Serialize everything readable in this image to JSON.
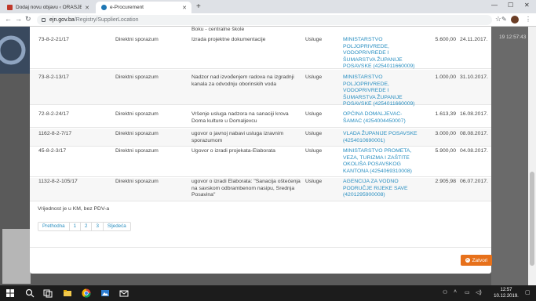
{
  "browser": {
    "tabs": [
      {
        "title": "Dodaj novu objavu ‹ ORAŠJE NET",
        "active": false
      },
      {
        "title": "e-Procurement",
        "active": true
      }
    ],
    "url_host": "ejn.gov.ba",
    "url_path": "/Registry/SupplierLocation"
  },
  "background": {
    "clock_fragment": "19 12:57:43"
  },
  "modal": {
    "top_cutoff_text": "Boku - centralne škole",
    "rows": [
      {
        "number": "73-8-2-21/17",
        "procedure": "Direktni sporazum",
        "subject": "Izrada projektne dokumentacije",
        "type": "Usluge",
        "authority": "MINISTARSTVO POLJOPRIVREDE, VODOPRIVREDE I ŠUMARSTVA ŽUPANIJE POSAVSKE (4254011660009)",
        "value": "5.600,00",
        "date": "24.11.2017."
      },
      {
        "number": "73-8-2-13/17",
        "procedure": "Direktni sporazum",
        "subject": "Nadzor nad izvođenjem radova na izgradnji kanala za odvodnju oborinskih voda",
        "type": "Usluge",
        "authority": "MINISTARSTVO POLJOPRIVREDE, VODOPRIVREDE I ŠUMARSTVA ŽUPANIJE POSAVSKE (4254011660009)",
        "value": "1.000,00",
        "date": "31.10.2017."
      },
      {
        "number": "72-8-2-24/17",
        "procedure": "Direktni sporazum",
        "subject": "Vršenje usluga nadzora na sanaciji krova Doma kulture u Domaljevcu",
        "type": "Usluge",
        "authority": "OPĆINA DOMALJEVAC-ŠAMAC (4254004450007)",
        "value": "1.613,39",
        "date": "16.08.2017."
      },
      {
        "number": "1162-8-2-7/17",
        "procedure": "Direktni sporazum",
        "subject": "ugovor o javnoj nabavi usluga izravnim sporazumom",
        "type": "Usluge",
        "authority": "VLADA ŽUPANIJE POSAVSKE (4254010690001)",
        "value": "3.000,00",
        "date": "08.08.2017."
      },
      {
        "number": "45-8-2-3/17",
        "procedure": "Direktni sporazum",
        "subject": "Ugovor o izradi projekata-Elaborata",
        "type": "Usluge",
        "authority": "MINISTARSTVO PROMETA, VEZA, TURIZMA I ZAŠTITE OKOLIŠA POSAVSKOG KANTONA (4254069310008)",
        "value": "5.900,00",
        "date": "04.08.2017."
      },
      {
        "number": "1132-8-2-105/17",
        "procedure": "Direktni sporazum",
        "subject": "ugovor o izradi Elaborata: \"Sanacija oštećenja na savskom odbrambenom nasipu, Srednja Posavina\"",
        "type": "Usluge",
        "authority": "AGENCIJA ZA VODNO PODRUČJE RIJEKE SAVE (4201295900008)",
        "value": "2.905,98",
        "date": "06.07.2017."
      }
    ],
    "note": "Vrijednost je u KM, bez PDV-a",
    "pagination": [
      "Prethodna",
      "1",
      "2",
      "3",
      "Sljedeća"
    ],
    "close_label": "Zatvori"
  },
  "taskbar": {
    "time": "12:57",
    "date": "10.12.2019."
  },
  "colors": {
    "accent_link": "#2a8fc1",
    "close_button": "#e7711b"
  }
}
